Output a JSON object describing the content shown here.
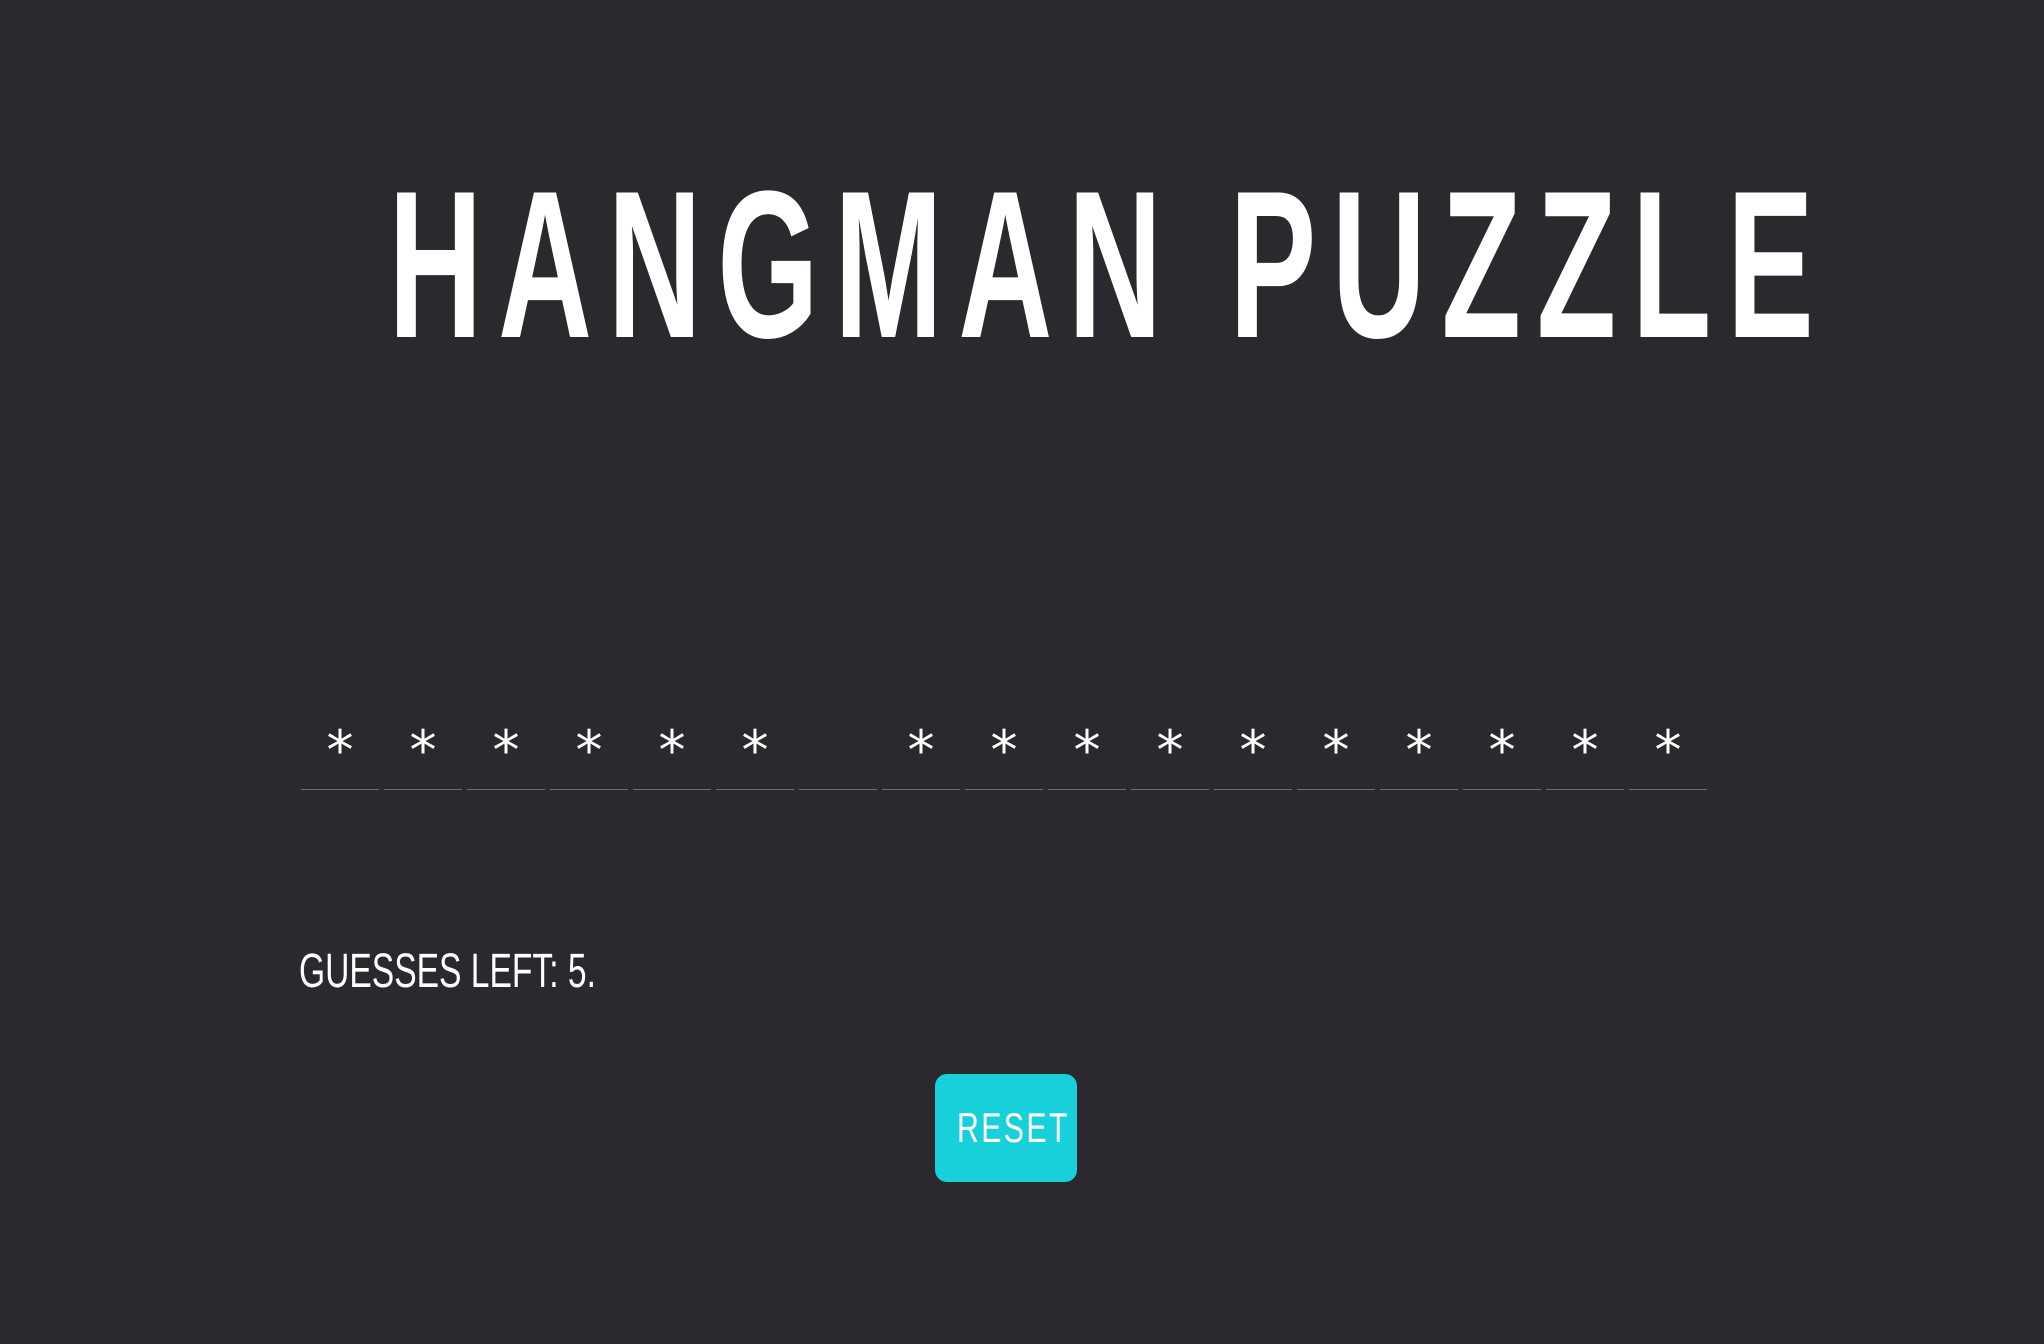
{
  "page": {
    "title": "Hangman Puzzle"
  },
  "puzzle": {
    "cells": [
      "*",
      "*",
      "*",
      "*",
      "*",
      "*",
      "",
      "*",
      "*",
      "*",
      "*",
      "*",
      "*",
      "*",
      "*",
      "*",
      "*"
    ]
  },
  "status": {
    "guesses_left": "Guesses left: 5."
  },
  "controls": {
    "reset_label": "Reset"
  },
  "colors": {
    "background": "#2b292e",
    "text": "#ffffff",
    "accent": "#18d0da",
    "underline": "#6f6c74"
  }
}
